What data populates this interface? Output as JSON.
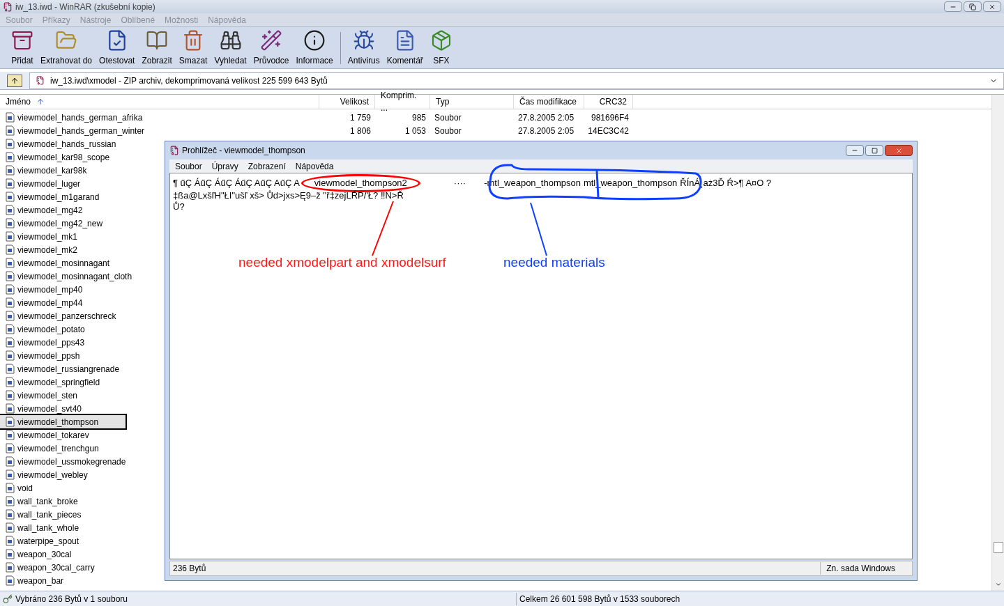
{
  "window": {
    "title": "iw_13.iwd - WinRAR (zkušební kopie)"
  },
  "menu": [
    "Soubor",
    "Příkazy",
    "Nástroje",
    "Oblíbené",
    "Možnosti",
    "Nápověda"
  ],
  "toolbar": [
    [
      "Přidat",
      "Extrahovat do",
      "Otestovat",
      "Zobrazit",
      "Smazat",
      "Vyhledat",
      "Průvodce",
      "Informace"
    ],
    [
      "Antivirus",
      "Komentář",
      "SFX"
    ]
  ],
  "address": "iw_13.iwd\\xmodel - ZIP archiv, dekomprimovaná velikost 225 599 643 Bytů",
  "columns": [
    "Jméno",
    "Velikost",
    "Komprim. ...",
    "Typ",
    "Čas modifikace",
    "CRC32"
  ],
  "rows": [
    {
      "name": "viewmodel_hands_german_afrika",
      "selected": false,
      "size": "1 759",
      "packed": "985",
      "type": "Soubor",
      "modified": "27.8.2005 2:05",
      "crc": "981696F4"
    },
    {
      "name": "viewmodel_hands_german_winter",
      "selected": false,
      "size": "1 806",
      "packed": "1 053",
      "type": "Soubor",
      "modified": "27.8.2005 2:05",
      "crc": "14EC3C42"
    },
    {
      "name": "viewmodel_hands_russian",
      "selected": false
    },
    {
      "name": "viewmodel_kar98_scope",
      "selected": false
    },
    {
      "name": "viewmodel_kar98k",
      "selected": false
    },
    {
      "name": "viewmodel_luger",
      "selected": false
    },
    {
      "name": "viewmodel_m1garand",
      "selected": false
    },
    {
      "name": "viewmodel_mg42",
      "selected": false
    },
    {
      "name": "viewmodel_mg42_new",
      "selected": false
    },
    {
      "name": "viewmodel_mk1",
      "selected": false
    },
    {
      "name": "viewmodel_mk2",
      "selected": false
    },
    {
      "name": "viewmodel_mosinnagant",
      "selected": false
    },
    {
      "name": "viewmodel_mosinnagant_cloth",
      "selected": false
    },
    {
      "name": "viewmodel_mp40",
      "selected": false
    },
    {
      "name": "viewmodel_mp44",
      "selected": false
    },
    {
      "name": "viewmodel_panzerschreck",
      "selected": false
    },
    {
      "name": "viewmodel_potato",
      "selected": false
    },
    {
      "name": "viewmodel_pps43",
      "selected": false
    },
    {
      "name": "viewmodel_ppsh",
      "selected": false
    },
    {
      "name": "viewmodel_russiangrenade",
      "selected": false
    },
    {
      "name": "viewmodel_springfield",
      "selected": false
    },
    {
      "name": "viewmodel_sten",
      "selected": false
    },
    {
      "name": "viewmodel_svt40",
      "selected": false
    },
    {
      "name": "viewmodel_thompson",
      "selected": true
    },
    {
      "name": "viewmodel_tokarev",
      "selected": false
    },
    {
      "name": "viewmodel_trenchgun",
      "selected": false
    },
    {
      "name": "viewmodel_ussmokegrenade",
      "selected": false
    },
    {
      "name": "viewmodel_webley",
      "selected": false
    },
    {
      "name": "void",
      "selected": false
    },
    {
      "name": "wall_tank_broke",
      "selected": false
    },
    {
      "name": "wall_tank_pieces",
      "selected": false
    },
    {
      "name": "wall_tank_whole",
      "selected": false
    },
    {
      "name": "waterpipe_spout",
      "selected": false
    },
    {
      "name": "weapon_30cal",
      "selected": false
    },
    {
      "name": "weapon_30cal_carry",
      "selected": false
    },
    {
      "name": "weapon_bar",
      "selected": false
    }
  ],
  "status_bar": {
    "selection": "Vybráno 236 Bytů v 1 souboru",
    "total": "Celkem 26 601 598 Bytů v 1533 souborech"
  },
  "viewer": {
    "title": "Prohlížeč - viewmodel_thompson",
    "menu": [
      "Soubor",
      "Úpravy",
      "Zobrazení",
      "Nápověda"
    ],
    "line_1": {
      "prefix": "¶ űÇ ÁűÇ ÁűÇ ÁűÇ AűÇ AűÇ A",
      "model": "viewmodel_thompson2",
      "dots": "····",
      "dash": "-",
      "material_1": "mtl_weapon_thompson",
      "material_2": "mtl_weapon_thompson",
      "suffix": "ŘÍnÁ¸aż3Ď Ŕ>¶ A¤O ?"
    },
    "line_2": "‡ßa@LxšľH\"ŁI\"ušľ xš> Ůd>jxs>Ę9–ž ''ř‡zejLŔP/'Ł? ‼N>Ř",
    "line_3": "Ů?",
    "status": "236 Bytů",
    "charset": "Zn. sada Windows"
  },
  "annotations": {
    "red_note": "needed xmodelpart and xmodelsurf",
    "blue_note": "needed materials"
  }
}
